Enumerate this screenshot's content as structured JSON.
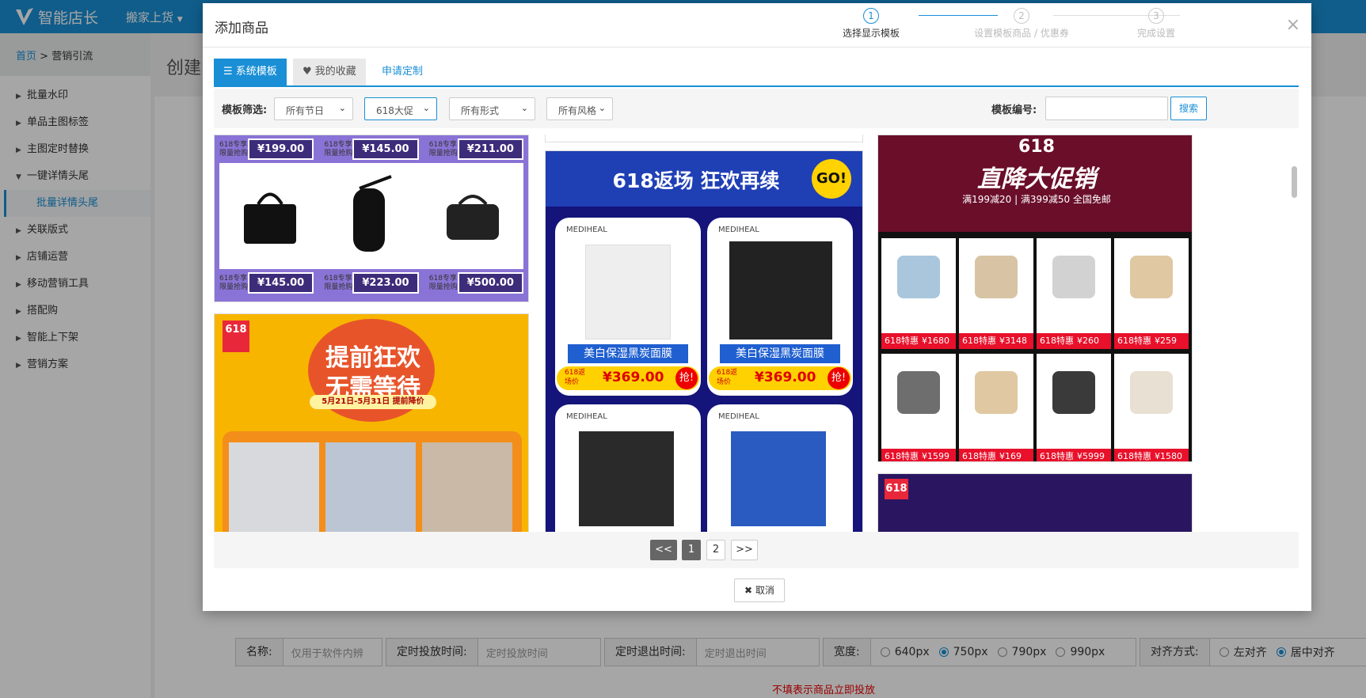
{
  "app": {
    "logo_text": "智能店长",
    "menu": "搬家上货"
  },
  "sidebar": {
    "breadcrumb_home": "首页",
    "breadcrumb_sep": ">",
    "breadcrumb_current": "营销引流",
    "items": [
      {
        "label": "批量水印"
      },
      {
        "label": "单品主图标签"
      },
      {
        "label": "主图定时替换"
      },
      {
        "label": "一键详情头尾"
      },
      {
        "label": "批量详情头尾"
      },
      {
        "label": "关联版式"
      },
      {
        "label": "店铺运营"
      },
      {
        "label": "移动营销工具"
      },
      {
        "label": "搭配购"
      },
      {
        "label": "智能上下架"
      },
      {
        "label": "营销方案"
      }
    ]
  },
  "page": {
    "title": "创建"
  },
  "modal": {
    "title": "添加商品",
    "close": "×",
    "steps": [
      {
        "num": "1",
        "label": "选择显示模板"
      },
      {
        "num": "2",
        "label": "设置模板商品 / 优惠券"
      },
      {
        "num": "3",
        "label": "完成设置"
      }
    ],
    "tabs": {
      "system": "系统模板",
      "favorites": "我的收藏",
      "custom": "申请定制"
    },
    "filter": {
      "label": "模板筛选:",
      "holiday": "所有节日",
      "promo": "618大促",
      "form": "所有形式",
      "style": "所有风格",
      "code_label": "模板编号:",
      "search": "搜索"
    },
    "templates": {
      "a_tag": "618专享\n限量抢购",
      "a_prices_top": [
        "¥199.00",
        "¥145.00",
        "¥211.00"
      ],
      "a_prices_bottom": [
        "¥145.00",
        "¥223.00",
        "¥500.00"
      ],
      "b_line1": "提前狂欢",
      "b_line2": "无需等待",
      "b_badge": "618",
      "b_date": "5月21日-5月31日 提前降价",
      "c_title": "618返场 狂欢再续",
      "c_go": "GO!",
      "c_brand": "MEDIHEAL",
      "c_product": "美白保湿黑炭面膜",
      "c_price": "¥369.00",
      "c_tag": "618返场价",
      "c_grab": "抢!",
      "d_title": "直降大促销",
      "d_sub": "满199减20 | 满399减50 全国免邮",
      "d_618": "618",
      "d_tag": "618特惠",
      "d_prices": [
        "¥1680",
        "¥3148",
        "¥260",
        "¥259",
        "¥1599",
        "¥169",
        "¥5999",
        "¥1580"
      ]
    },
    "pager": {
      "prev": "<<",
      "p1": "1",
      "p2": "2",
      "next": ">>"
    },
    "cancel": "取消"
  },
  "form": {
    "name_label": "名称:",
    "name_ph": "仅用于软件内辨",
    "start_label": "定时投放时间:",
    "start_ph": "定时投放时间",
    "end_label": "定时退出时间:",
    "end_ph": "定时退出时间",
    "width_label": "宽度:",
    "widths": [
      "640px",
      "750px",
      "790px",
      "990px"
    ],
    "align_label": "对齐方式:",
    "align_left": "左对齐",
    "align_center": "居中对齐"
  },
  "hint": "不填表示商品立即投放",
  "colors": {
    "accent": "#1a8fd6",
    "purple": "#3d2c7a",
    "red": "#e00"
  }
}
